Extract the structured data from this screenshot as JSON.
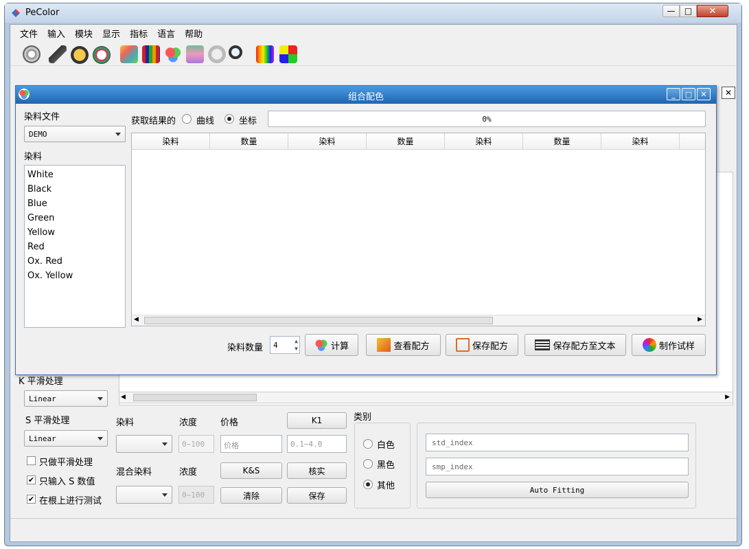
{
  "app": {
    "title": "PeColor",
    "menu": [
      "文件",
      "输入",
      "模块",
      "显示",
      "指标",
      "语言",
      "帮助"
    ]
  },
  "toolbar_icons": [
    "gear-icon",
    "measure-icon",
    "open-folder-icon",
    "ring-icon",
    "palette-icon",
    "color-grid-icon",
    "color-circles-icon",
    "color-chart-icon",
    "paint-palette-icon",
    "magnify-icon",
    "spectrum-icon",
    "color-blocks-icon"
  ],
  "dialog": {
    "title": "组合配色",
    "dye_file_label": "染料文件",
    "dye_file_value": "DEMO",
    "dye_label": "染料",
    "dyes": [
      "White",
      "Black",
      "Blue",
      "Green",
      "Yellow",
      "Red",
      "Ox. Red",
      "Ox. Yellow"
    ],
    "result_label": "获取结果的",
    "opt_curve": "曲线",
    "opt_coord": "坐标",
    "progress": "0%",
    "columns": [
      "染料",
      "数量",
      "染料",
      "数量",
      "染料",
      "数量",
      "染料"
    ],
    "count_label": "染料数量",
    "count_value": "4",
    "btn_calc": "计算",
    "btn_view": "查看配方",
    "btn_save": "保存配方",
    "btn_save_text": "保存配方至文本",
    "btn_make": "制作试样"
  },
  "bottom": {
    "k_smooth_label": "K 平滑处理",
    "k_smooth_value": "Linear",
    "s_smooth_label": "S 平滑处理",
    "s_smooth_value": "Linear",
    "chk_smooth_only": "只做平滑处理",
    "chk_s_only": "只输入 S 数值",
    "chk_root_test": "在根上进行测试",
    "dye_label": "染料",
    "conc_label": "浓度",
    "price_label": "价格",
    "conc_placeholder": "0~100",
    "price_placeholder": "价格",
    "k1_placeholder": "0.1~4.0",
    "btn_k1": "K1",
    "mix_label": "混合染料",
    "conc2_label": "浓度",
    "conc2_placeholder": "0~100",
    "btn_ks": "K&S",
    "btn_check": "核实",
    "btn_clear": "清除",
    "btn_save": "保存",
    "category_label": "类别",
    "cat_white": "白色",
    "cat_black": "黑色",
    "cat_other": "其他",
    "std_index": "std_index",
    "smp_index": "smp_index",
    "btn_fit": "Auto Fitting"
  }
}
